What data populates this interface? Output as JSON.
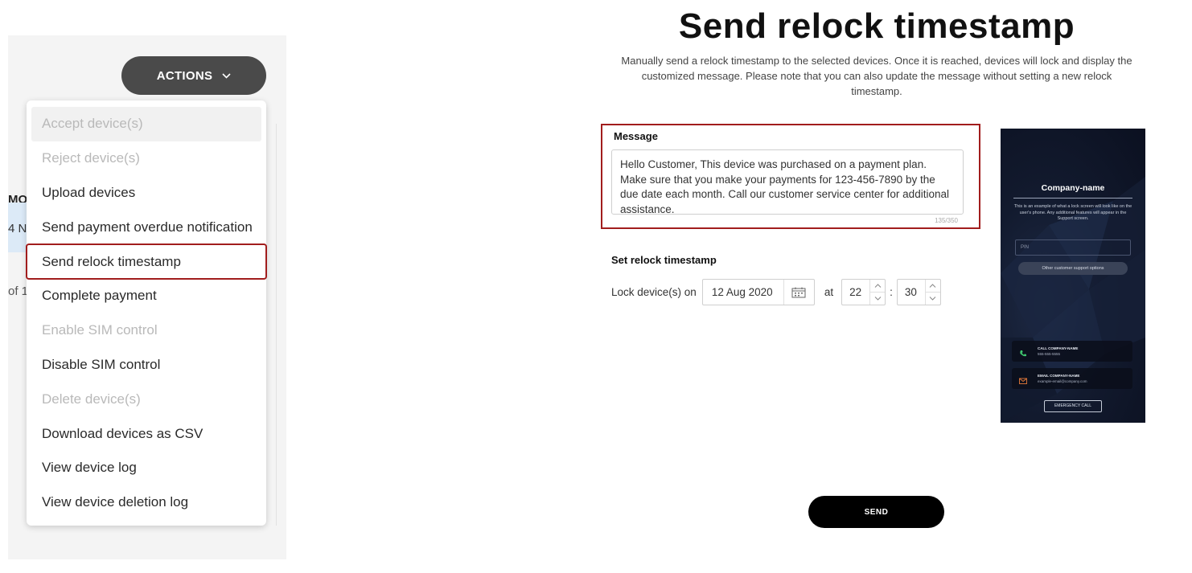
{
  "left": {
    "column_header_partial": "MOI",
    "row_partial": "4 N",
    "pager_partial": "of 1",
    "actions_label": "ACTIONS",
    "menu_items": [
      {
        "label": "Accept device(s)",
        "disabled": true
      },
      {
        "label": "Reject device(s)",
        "disabled": true
      },
      {
        "label": "Upload devices",
        "disabled": false
      },
      {
        "label": "Send payment overdue notification",
        "disabled": false
      },
      {
        "label": "Send relock timestamp",
        "disabled": false,
        "highlighted": true
      },
      {
        "label": "Complete payment",
        "disabled": false
      },
      {
        "label": "Enable SIM control",
        "disabled": true
      },
      {
        "label": "Disable SIM control",
        "disabled": false
      },
      {
        "label": "Delete device(s)",
        "disabled": true
      },
      {
        "label": "Download devices as CSV",
        "disabled": false
      },
      {
        "label": "View device log",
        "disabled": false
      },
      {
        "label": "View device deletion log",
        "disabled": false
      }
    ]
  },
  "form": {
    "title": "Send relock timestamp",
    "description": "Manually send a relock timestamp to the selected devices. Once it is reached, devices will lock and display the customized message. Please note that you can also update the message without setting a new relock timestamp.",
    "message_label": "Message",
    "message_text": "Hello Customer, This device was purchased on a payment plan. Make sure that you make your payments for 123-456-7890 by the due date each month. Call our customer service center for additional assistance.",
    "message_count": "135/350",
    "relock_label": "Set relock timestamp",
    "lock_on_label": "Lock device(s) on",
    "date_value": "12 Aug 2020",
    "at_label": "at",
    "hour_value": "22",
    "colon": ":",
    "minute_value": "30",
    "send_label": "SEND"
  },
  "preview": {
    "company": "Company-name",
    "info": "This is an example of what a lock screen will look like on the user's phone. Any additional features will appear in the Support screen.",
    "pin_placeholder": "PIN",
    "support_label": "Other customer support options",
    "call_title": "CALL COMPANY-NAME",
    "call_number": "555-555-5555",
    "email_title": "EMAIL COMPANY-NAME",
    "email_address": "example-email@company.com",
    "emergency_label": "EMERGENCY CALL"
  },
  "colors": {
    "highlight": "#a11d1d",
    "actions_button": "#4a4a4a",
    "send_button": "#000000",
    "disabled_text": "#b9b9b9"
  },
  "icons": [
    "chevron-down-icon",
    "calendar-icon",
    "chevron-up-icon",
    "phone-icon",
    "mail-icon"
  ]
}
